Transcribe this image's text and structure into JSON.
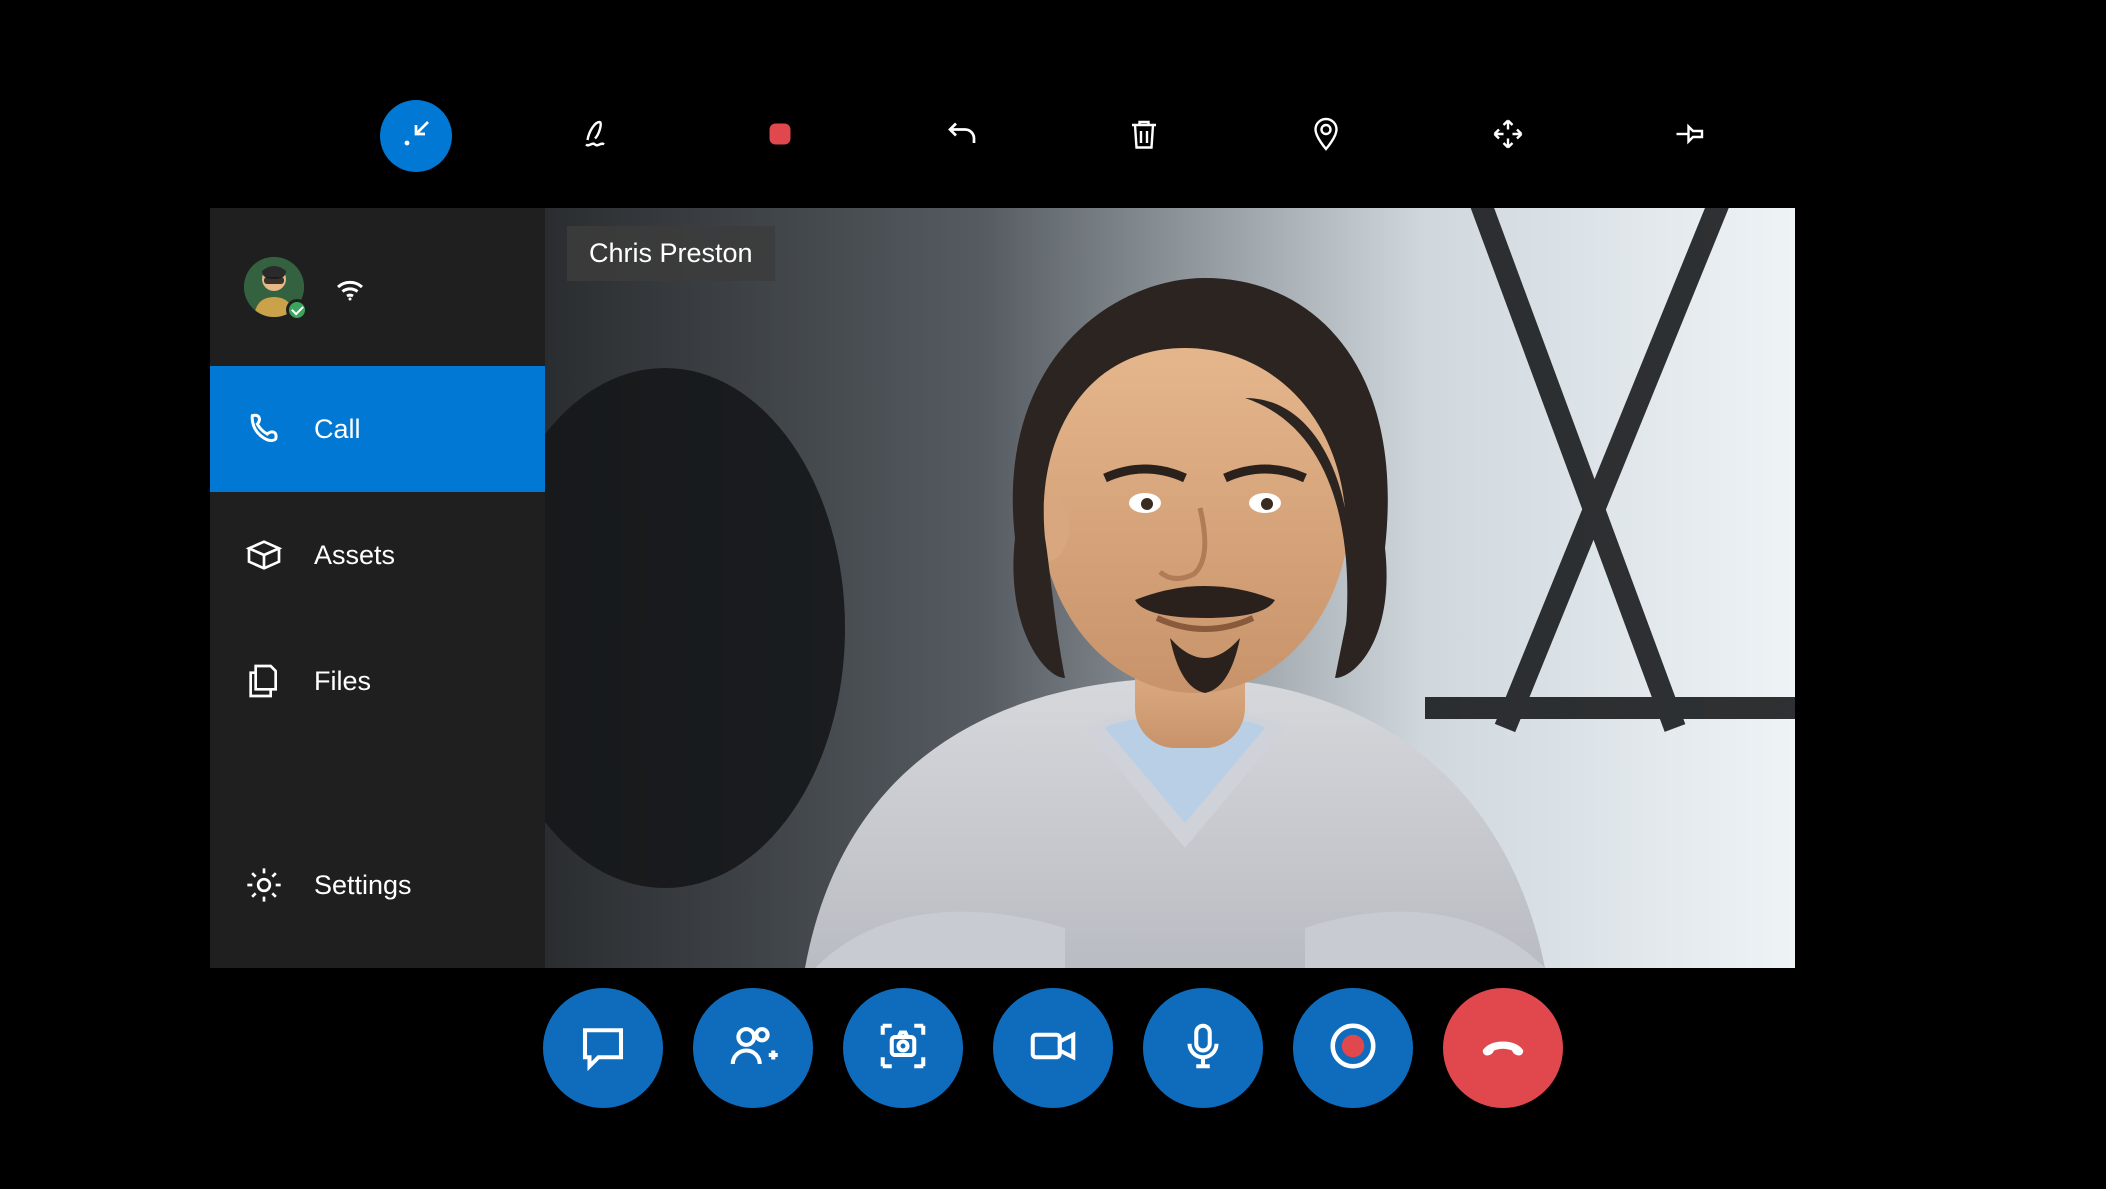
{
  "participant": {
    "name": "Chris Preston"
  },
  "sidebar": {
    "items": [
      {
        "label": "Call"
      },
      {
        "label": "Assets"
      },
      {
        "label": "Files"
      },
      {
        "label": "Settings"
      }
    ]
  },
  "top_toolbar": {
    "icons": [
      "minimize-icon",
      "ink-icon",
      "stop-shape-icon",
      "undo-icon",
      "delete-icon",
      "location-icon",
      "move-icon",
      "pin-icon"
    ]
  },
  "call_controls": {
    "icons": [
      "chat-icon",
      "add-participant-icon",
      "camera-capture-icon",
      "video-icon",
      "microphone-icon",
      "record-icon",
      "hangup-icon"
    ]
  },
  "colors": {
    "accent": "#0078d4",
    "button": "#0f6cbd",
    "hangup": "#e0484d",
    "record_dot": "#e0484d",
    "stop_square": "#e0484d",
    "sidebar_bg": "#1f1f1f",
    "presence_online": "#3ba55d"
  }
}
